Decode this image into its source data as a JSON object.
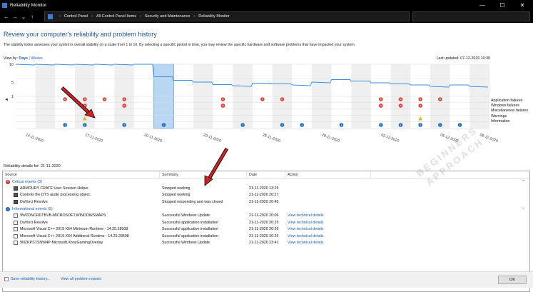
{
  "window": {
    "title": "Reliability Monitor",
    "minimize": "—",
    "maximize": "☐",
    "close": "✕"
  },
  "nav": {
    "back": "←",
    "forward": "→",
    "up": "↑",
    "down": "⌄"
  },
  "breadcrumb": [
    "Control Panel",
    "All Control Panel Items",
    "Security and Maintenance",
    "Reliability Monitor"
  ],
  "page": {
    "title": "Review your computer's reliability and problem history",
    "description": "The stability index assesses your system's overall stability on a scale from 1 to 10. By selecting a specific period in time, you may review the specific hardware and software problems that have impacted your system.",
    "view_by_label": "View by:",
    "view_days": "Days",
    "view_sep": "|",
    "view_weeks": "Weeks",
    "last_updated": "Last updated: 07-12-2020 10:30"
  },
  "chart": {
    "yticks": [
      "10",
      "5",
      "1"
    ],
    "scroll_left": "◄",
    "dates": [
      "14-11-2020",
      "17-11-2020",
      "20-11-2020",
      "23-11-2020",
      "26-11-2020",
      "29-11-2020",
      "02-12-2020",
      "05-12-2020",
      "06-12-2020"
    ],
    "categories": [
      "Application failures",
      "Windows failures",
      "Miscellaneous failures",
      "Warnings",
      "Information"
    ],
    "selected_day": "21-11-2020"
  },
  "chart_data": {
    "type": "line",
    "title": "",
    "ylim": [
      1,
      10
    ],
    "x": [
      "14-11-2020",
      "15-11-2020",
      "16-11-2020",
      "17-11-2020",
      "18-11-2020",
      "19-11-2020",
      "20-11-2020",
      "21-11-2020",
      "22-11-2020",
      "23-11-2020",
      "24-11-2020",
      "25-11-2020",
      "26-11-2020",
      "27-11-2020",
      "28-11-2020",
      "29-11-2020",
      "30-11-2020",
      "01-12-2020",
      "02-12-2020",
      "03-12-2020",
      "04-12-2020",
      "05-12-2020",
      "06-12-2020",
      "07-12-2020"
    ],
    "series": [
      {
        "values": [
          10,
          10,
          10,
          10,
          10,
          10,
          10,
          6.5,
          5.5,
          5,
          4.3,
          4.0,
          4.7,
          4.5,
          4.2,
          5.0,
          5.7,
          5.3,
          4.8,
          4.5,
          4.2,
          3.8,
          4.2,
          3.8
        ]
      }
    ],
    "events": {
      "application_failures": [
        2,
        3,
        4,
        5,
        10,
        12,
        13,
        18,
        19,
        20,
        21
      ],
      "windows_failures": [],
      "miscellaneous_failures": [],
      "warnings": [
        3,
        20
      ],
      "information": [
        2,
        3,
        5,
        7,
        11,
        13,
        14,
        16,
        18,
        19,
        20,
        21,
        22
      ]
    }
  },
  "details": {
    "title": "Reliability details for: 21-11-2020",
    "columns": [
      "Source",
      "Summary",
      "Date",
      "Action"
    ],
    "critical_label": "Critical events (3)",
    "critical": [
      {
        "source": "ARMOURY CRATE User Session Helper",
        "summary": "Stopped working",
        "date": "21-11-2020 13:25",
        "action": ""
      },
      {
        "source": "Controls the DTS audio processing object.",
        "summary": "Stopped working",
        "date": "21-11-2020 20:27",
        "action": ""
      },
      {
        "source": "DaVinci Resolve",
        "summary": "Stopped responding and was closed",
        "date": "21-11-2020 20:45",
        "action": ""
      }
    ],
    "info_label": "Informational events (5)",
    "info": [
      {
        "source": "9WZDNCRDTBVB-MICROSOFT.WINDOWSMAPS",
        "summary": "Successful Windows Update",
        "date": "21-11-2020 20:06",
        "action": "View technical details"
      },
      {
        "source": "DaVinci Resolve",
        "summary": "Successful application installation",
        "date": "21-11-2020 20:25",
        "action": "View technical details"
      },
      {
        "source": "Microsoft Visual C++ 2019 X64 Minimum Runtime - 14.25.28508",
        "summary": "Successful application installation",
        "date": "21-11-2020 20:26",
        "action": "View technical details"
      },
      {
        "source": "Microsoft Visual C++ 2019 X64 Additional Runtime - 14.25.28508",
        "summary": "Successful application installation",
        "date": "21-11-2020 20:26",
        "action": "View technical details"
      },
      {
        "source": "9NZKPSTSNW4P-Microsoft.XboxGamingOverlay",
        "summary": "Successful Windows Update",
        "date": "21-11-2020 23:41",
        "action": "View technical details"
      }
    ]
  },
  "footer": {
    "save": "Save reliability history...",
    "view_all": "View all problem reports",
    "ok": "OK"
  },
  "watermark": {
    "line1": "BEGINNERS",
    "line2": "APPROACH"
  }
}
